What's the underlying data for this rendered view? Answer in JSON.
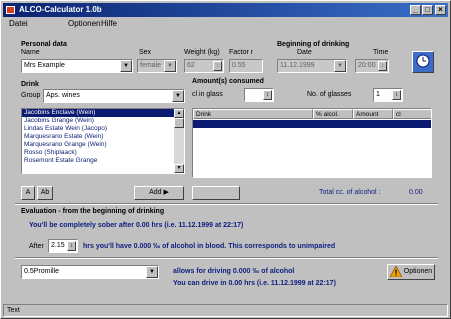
{
  "window": {
    "title": "ALCO-Calculator 1.0b"
  },
  "menu": [
    "Datei",
    "Optionen",
    "Hilfe"
  ],
  "personal": {
    "heading": "Personal data",
    "name_label": "Name",
    "name_value": "Mrs Example",
    "sex_label": "Sex",
    "sex_value": "female",
    "weight_label": "Weight (kg)",
    "weight_value": "62",
    "factor_label": "Factor r",
    "factor_value": "0.55"
  },
  "beginning": {
    "heading": "Beginning of drinking",
    "date_label": "Date",
    "date_value": "11.12.1999",
    "time_label": "Time",
    "time_value": "20:00"
  },
  "drinks": {
    "heading": "Drink",
    "group_label": "Group",
    "group_value": "Aps. wines",
    "items": [
      "Jacobins Enclave (Wein)",
      "Jacobins Grange (Wein)",
      "Lindas Estate Wein (Jacopo)",
      "Marquesrano Estate (Wein)",
      "Marquesrano Grange (Wein)",
      "Rosso (Shiplaack)",
      "Rosemont Estate Grange"
    ],
    "selected_index": 0
  },
  "consumed": {
    "heading": "Amount(s) consumed",
    "glass_label": "cl in glass",
    "glass_value": "",
    "count_label": "No. of glasses",
    "count_value": "1"
  },
  "table": {
    "columns": [
      "Drink",
      "% alcol.",
      "Amount",
      "cl"
    ]
  },
  "buttons": {
    "btn_a": "A",
    "btn_b": "Ab",
    "add": "Add ▶",
    "remove": "",
    "options": "Optionen"
  },
  "total": {
    "label": "Total cc. of alcohol :",
    "value": "0.00"
  },
  "evaluation": {
    "heading": "Evaluation - from the beginning of drinking",
    "sober_text": "You'll be completely sober after 0.00 hrs (i.e. 11.12.1999 at 22:17)",
    "after_label": "After",
    "after_value": "2.15",
    "after_text": "hrs you'll have 0.000 ‰ of alcohol in blood. This corresponds to unimpaired",
    "limit_select": "0.5Promille",
    "allowed_text": "allows for driving 0.000 ‰ of alcohol",
    "drive_text": "You can drive in      0.00 hrs (i.e. 11.12.1999 at 22:17)"
  },
  "status": {
    "text": "Text"
  }
}
